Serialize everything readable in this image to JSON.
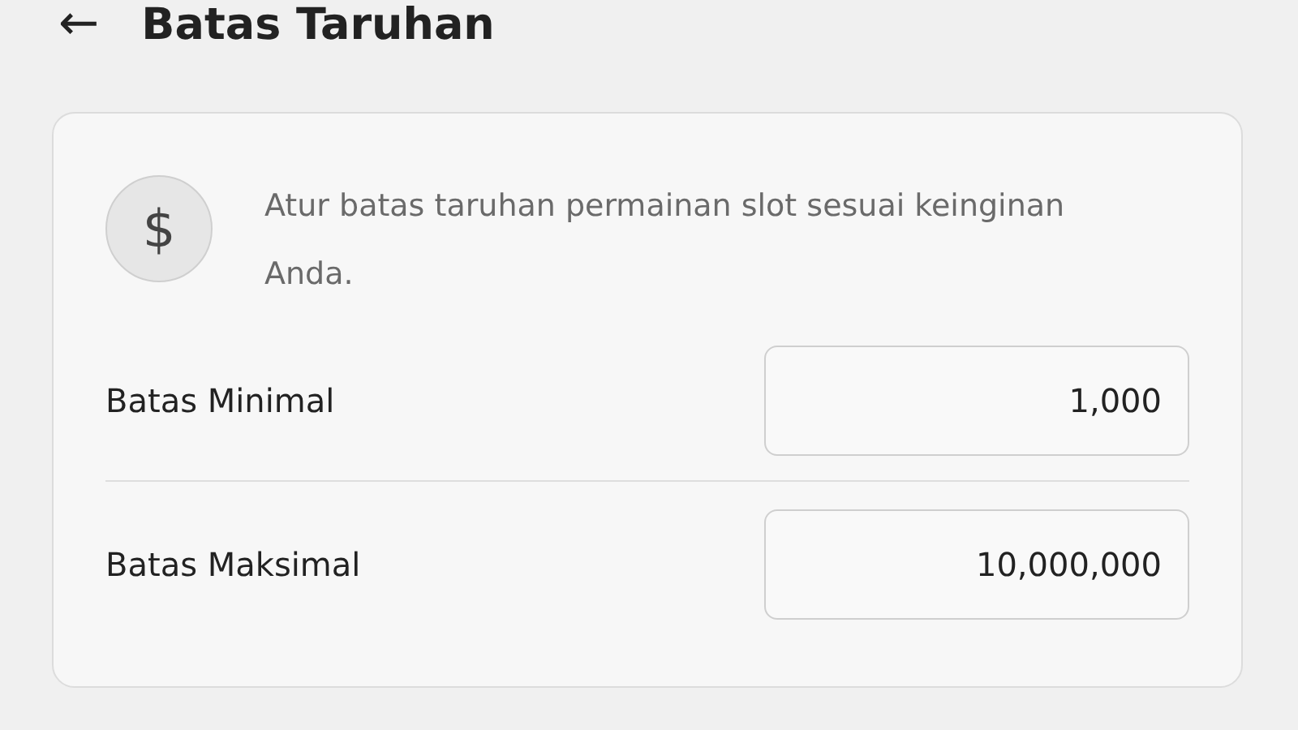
{
  "header": {
    "back_icon": "←",
    "title": "Batas Taruhan"
  },
  "card": {
    "icon_glyph": "$",
    "description": "Atur batas taruhan permainan slot sesuai keinginan Anda.",
    "fields": [
      {
        "label": "Batas Minimal",
        "value": "1,000"
      },
      {
        "label": "Batas Maksimal",
        "value": "10,000,000"
      }
    ]
  }
}
